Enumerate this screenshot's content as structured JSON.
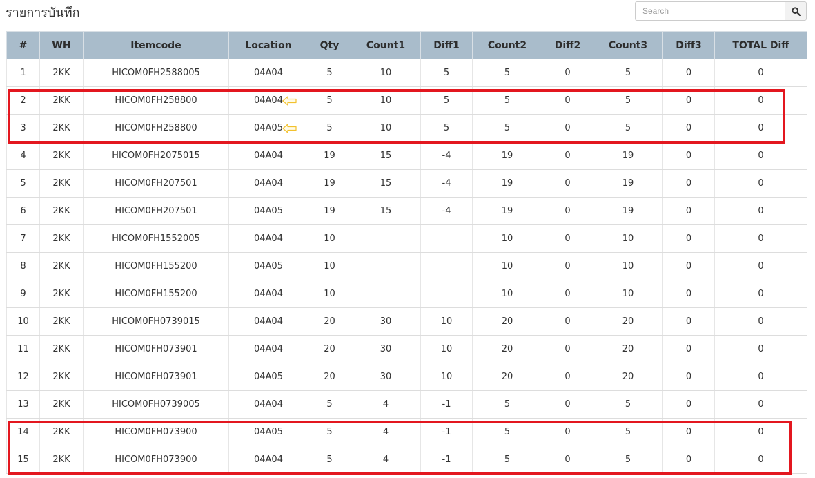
{
  "header": {
    "title": "รายการบันทึก"
  },
  "search": {
    "placeholder": "Search",
    "value": ""
  },
  "icons": {
    "search": "search-icon",
    "row_arrow": "arrow-left-icon"
  },
  "colors": {
    "header_bg": "#a9bccb",
    "highlight": "#e3171f",
    "arrow": "#f2c12e"
  },
  "table": {
    "columns": [
      "#",
      "WH",
      "Itemcode",
      "Location",
      "Qty",
      "Count1",
      "Diff1",
      "Count2",
      "Diff2",
      "Count3",
      "Diff3",
      "TOTAL Diff"
    ],
    "rows": [
      {
        "no": "1",
        "wh": "2KK",
        "itemcode": "HICOM0FH2588005",
        "location": "04A04",
        "qty": "5",
        "count1": "10",
        "diff1": "5",
        "count2": "5",
        "diff2": "0",
        "count3": "5",
        "diff3": "0",
        "total_diff": "0"
      },
      {
        "no": "2",
        "wh": "2KK",
        "itemcode": "HICOM0FH258800",
        "location": "04A04",
        "qty": "5",
        "count1": "10",
        "diff1": "5",
        "count2": "5",
        "diff2": "0",
        "count3": "5",
        "diff3": "0",
        "total_diff": "0"
      },
      {
        "no": "3",
        "wh": "2KK",
        "itemcode": "HICOM0FH258800",
        "location": "04A05",
        "qty": "5",
        "count1": "10",
        "diff1": "5",
        "count2": "5",
        "diff2": "0",
        "count3": "5",
        "diff3": "0",
        "total_diff": "0"
      },
      {
        "no": "4",
        "wh": "2KK",
        "itemcode": "HICOM0FH2075015",
        "location": "04A04",
        "qty": "19",
        "count1": "15",
        "diff1": "-4",
        "count2": "19",
        "diff2": "0",
        "count3": "19",
        "diff3": "0",
        "total_diff": "0"
      },
      {
        "no": "5",
        "wh": "2KK",
        "itemcode": "HICOM0FH207501",
        "location": "04A04",
        "qty": "19",
        "count1": "15",
        "diff1": "-4",
        "count2": "19",
        "diff2": "0",
        "count3": "19",
        "diff3": "0",
        "total_diff": "0"
      },
      {
        "no": "6",
        "wh": "2KK",
        "itemcode": "HICOM0FH207501",
        "location": "04A05",
        "qty": "19",
        "count1": "15",
        "diff1": "-4",
        "count2": "19",
        "diff2": "0",
        "count3": "19",
        "diff3": "0",
        "total_diff": "0"
      },
      {
        "no": "7",
        "wh": "2KK",
        "itemcode": "HICOM0FH1552005",
        "location": "04A04",
        "qty": "10",
        "count1": "",
        "diff1": "",
        "count2": "10",
        "diff2": "0",
        "count3": "10",
        "diff3": "0",
        "total_diff": "0"
      },
      {
        "no": "8",
        "wh": "2KK",
        "itemcode": "HICOM0FH155200",
        "location": "04A05",
        "qty": "10",
        "count1": "",
        "diff1": "",
        "count2": "10",
        "diff2": "0",
        "count3": "10",
        "diff3": "0",
        "total_diff": "0"
      },
      {
        "no": "9",
        "wh": "2KK",
        "itemcode": "HICOM0FH155200",
        "location": "04A04",
        "qty": "10",
        "count1": "",
        "diff1": "",
        "count2": "10",
        "diff2": "0",
        "count3": "10",
        "diff3": "0",
        "total_diff": "0"
      },
      {
        "no": "10",
        "wh": "2KK",
        "itemcode": "HICOM0FH0739015",
        "location": "04A04",
        "qty": "20",
        "count1": "30",
        "diff1": "10",
        "count2": "20",
        "diff2": "0",
        "count3": "20",
        "diff3": "0",
        "total_diff": "0"
      },
      {
        "no": "11",
        "wh": "2KK",
        "itemcode": "HICOM0FH073901",
        "location": "04A04",
        "qty": "20",
        "count1": "30",
        "diff1": "10",
        "count2": "20",
        "diff2": "0",
        "count3": "20",
        "diff3": "0",
        "total_diff": "0"
      },
      {
        "no": "12",
        "wh": "2KK",
        "itemcode": "HICOM0FH073901",
        "location": "04A05",
        "qty": "20",
        "count1": "30",
        "diff1": "10",
        "count2": "20",
        "diff2": "0",
        "count3": "20",
        "diff3": "0",
        "total_diff": "0"
      },
      {
        "no": "13",
        "wh": "2KK",
        "itemcode": "HICOM0FH0739005",
        "location": "04A04",
        "qty": "5",
        "count1": "4",
        "diff1": "-1",
        "count2": "5",
        "diff2": "0",
        "count3": "5",
        "diff3": "0",
        "total_diff": "0"
      },
      {
        "no": "14",
        "wh": "2KK",
        "itemcode": "HICOM0FH073900",
        "location": "04A05",
        "qty": "5",
        "count1": "4",
        "diff1": "-1",
        "count2": "5",
        "diff2": "0",
        "count3": "5",
        "diff3": "0",
        "total_diff": "0"
      },
      {
        "no": "15",
        "wh": "2KK",
        "itemcode": "HICOM0FH073900",
        "location": "04A04",
        "qty": "5",
        "count1": "4",
        "diff1": "-1",
        "count2": "5",
        "diff2": "0",
        "count3": "5",
        "diff3": "0",
        "total_diff": "0"
      }
    ]
  },
  "annotations": {
    "arrow_rows": [
      "2",
      "3"
    ],
    "highlight_groups": [
      [
        "2",
        "3"
      ],
      [
        "14",
        "15"
      ]
    ]
  }
}
